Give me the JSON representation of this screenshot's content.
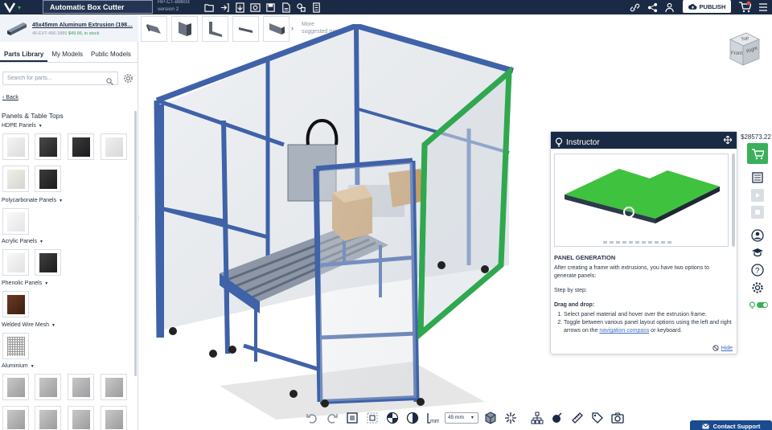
{
  "header": {
    "project_title": "Automatic Box Cutter",
    "project_id": "HP-CT-88803",
    "version": "version 2",
    "publish_label": "PUBLISH",
    "icons_left": [
      "open-folder-icon",
      "import-icon",
      "export-icon",
      "render-icon",
      "save-icon",
      "download-icon",
      "parts-icon",
      "bom-icon"
    ],
    "icons_right": [
      "link-icon",
      "share-icon",
      "user-add-icon",
      "cloud-upload-icon",
      "cart-icon",
      "more-icon"
    ]
  },
  "selected_part": {
    "name": "45x45mm Aluminum Extrusion (198…",
    "sku": "45-EXT-456-3985",
    "price": "$49.96, in stock"
  },
  "left_tabs": [
    {
      "label": "Parts Library",
      "active": true
    },
    {
      "label": "My Models",
      "active": false
    },
    {
      "label": "Public Models",
      "active": false
    }
  ],
  "search": {
    "placeholder": "Search for parts..."
  },
  "back_label": "Back",
  "section_title": "Panels & Table Tops",
  "categories": [
    {
      "label": "HDPE Panels"
    },
    {
      "label": "Polycarbonate Panels"
    },
    {
      "label": "Acrylic Panels"
    },
    {
      "label": "Phenolic Panels"
    },
    {
      "label": "Welded Wire Mesh"
    },
    {
      "label": "Aluminium"
    }
  ],
  "suggested": {
    "more_label": "More",
    "more_sub": "suggested parts"
  },
  "viewcube": {
    "top_label": "Top",
    "front_label": "Front",
    "right_label": "Right"
  },
  "instructor": {
    "title": "Instructor",
    "heading": "PANEL GENERATION",
    "intro": "After creating a frame with extrusions, you have two options to generate panels:",
    "step_label": "Step by step:",
    "subheading": "Drag and drop:",
    "steps": [
      "Select panel material and hover over the extrusion frame.",
      "Toggle between various panel layout options using the left and right arrows on the navigation compass or keyboard."
    ],
    "link_text": "navigation compass",
    "hide_label": "Hide"
  },
  "total_price": "$28573.22",
  "bottom_toolbar": {
    "unit": "mm",
    "size_value": "45 mm"
  },
  "contact_label": "Contact Support",
  "colors": {
    "navy": "#1b2a44",
    "frame_blue": "#3f62a8",
    "highlight_green": "#2fa84f",
    "cart_green": "#3ab05a"
  }
}
